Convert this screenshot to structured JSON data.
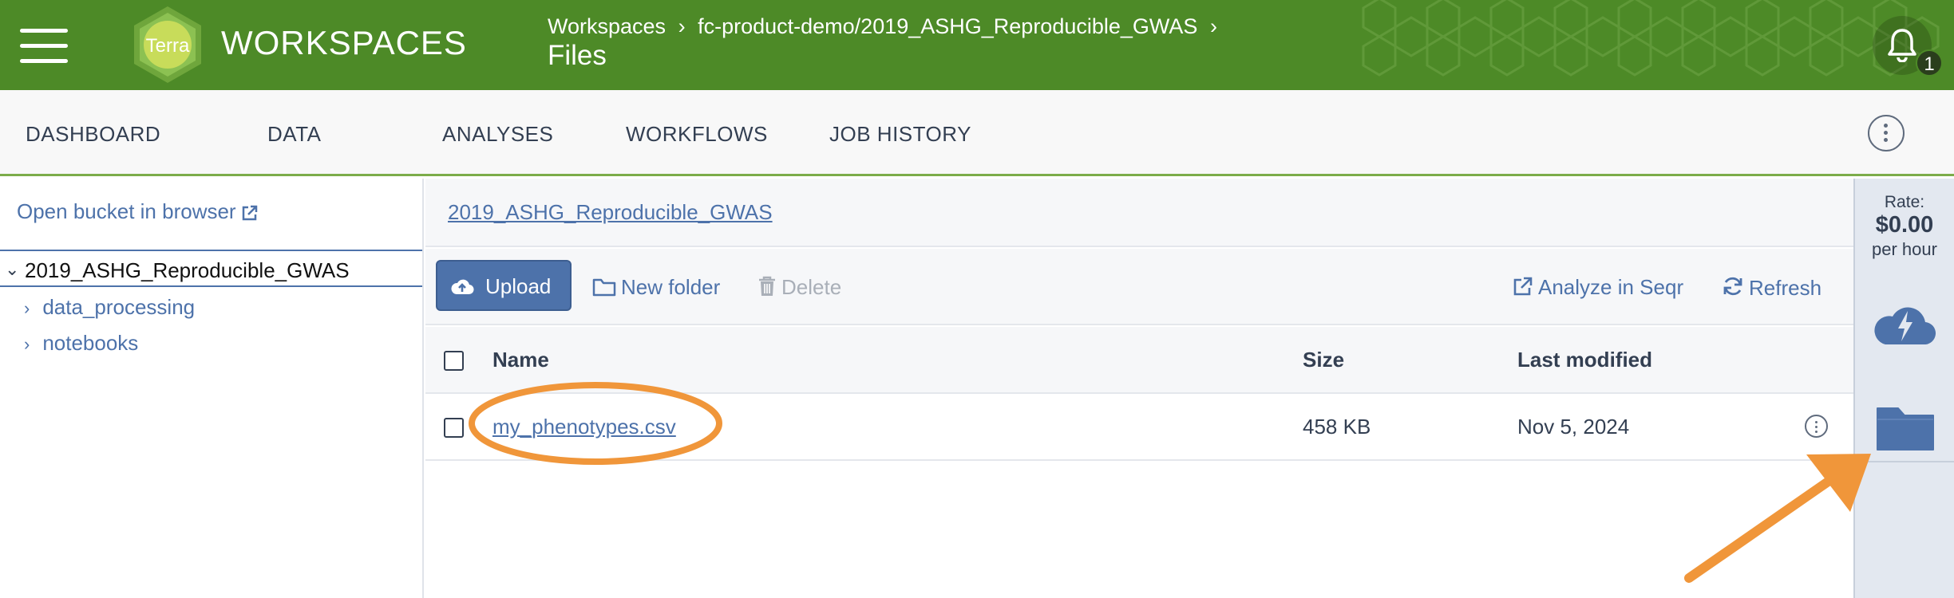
{
  "header": {
    "brand": "WORKSPACES",
    "logo_text": "Terra",
    "breadcrumb": [
      "Workspaces",
      "fc-product-demo/2019_ASHG_Reproducible_GWAS"
    ],
    "breadcrumb_separator": "›",
    "page_title": "Files",
    "notification_count": "1"
  },
  "tabs": [
    {
      "label": "DASHBOARD"
    },
    {
      "label": "DATA"
    },
    {
      "label": "ANALYSES"
    },
    {
      "label": "WORKFLOWS"
    },
    {
      "label": "JOB HISTORY"
    }
  ],
  "sidebar": {
    "open_bucket_label": "Open bucket in browser",
    "root": {
      "label": "2019_ASHG_Reproducible_GWAS",
      "expanded": true
    },
    "folders": [
      {
        "label": "data_processing"
      },
      {
        "label": "notebooks"
      }
    ]
  },
  "browser": {
    "current_path": "2019_ASHG_Reproducible_GWAS",
    "toolbar": {
      "upload": "Upload",
      "new_folder": "New folder",
      "delete": "Delete",
      "analyze": "Analyze in Seqr",
      "refresh": "Refresh"
    },
    "columns": {
      "name": "Name",
      "size": "Size",
      "modified": "Last modified"
    },
    "rows": [
      {
        "name": "my_phenotypes.csv",
        "size": "458 KB",
        "modified": "Nov 5, 2024"
      }
    ]
  },
  "rail": {
    "rate_label": "Rate:",
    "rate_value": "$0.00",
    "rate_unit": "per hour"
  },
  "colors": {
    "header_green": "#4d8a27",
    "link_blue": "#4d72aa",
    "annotation_orange": "#f0963a",
    "rail_bg": "#e3e8f0"
  },
  "icons": [
    "menu-icon",
    "terra-logo",
    "bell-icon",
    "kebab-icon",
    "external-link-icon",
    "cloud-upload-icon",
    "folder-icon",
    "trash-icon",
    "refresh-icon",
    "cloud-lightning-icon"
  ]
}
